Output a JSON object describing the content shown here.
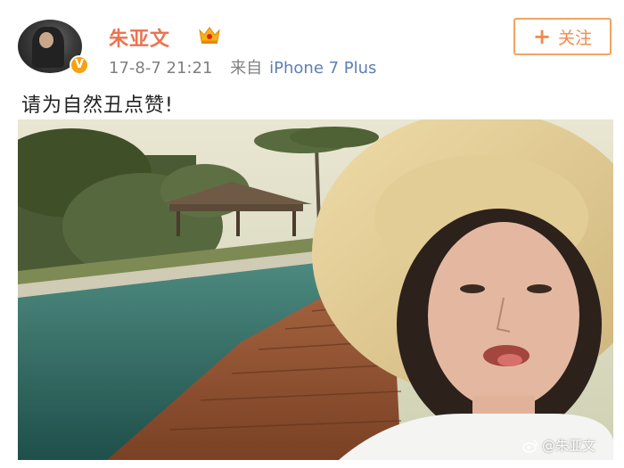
{
  "post": {
    "username": "朱亚文",
    "timestamp": "17-8-7 21:21",
    "from_label": "来自",
    "source": "iPhone 7 Plus",
    "text": "请为自然丑点赞!",
    "verified_badge": "V"
  },
  "follow_button": {
    "label": "关注",
    "icon": "plus-icon"
  },
  "watermark": {
    "text": "@朱亚文",
    "icon": "weibo-icon"
  },
  "colors": {
    "username": "#eb7350",
    "source_link": "#5d7fb4",
    "follow_border": "#f0a463",
    "verified": "#f7a113"
  }
}
